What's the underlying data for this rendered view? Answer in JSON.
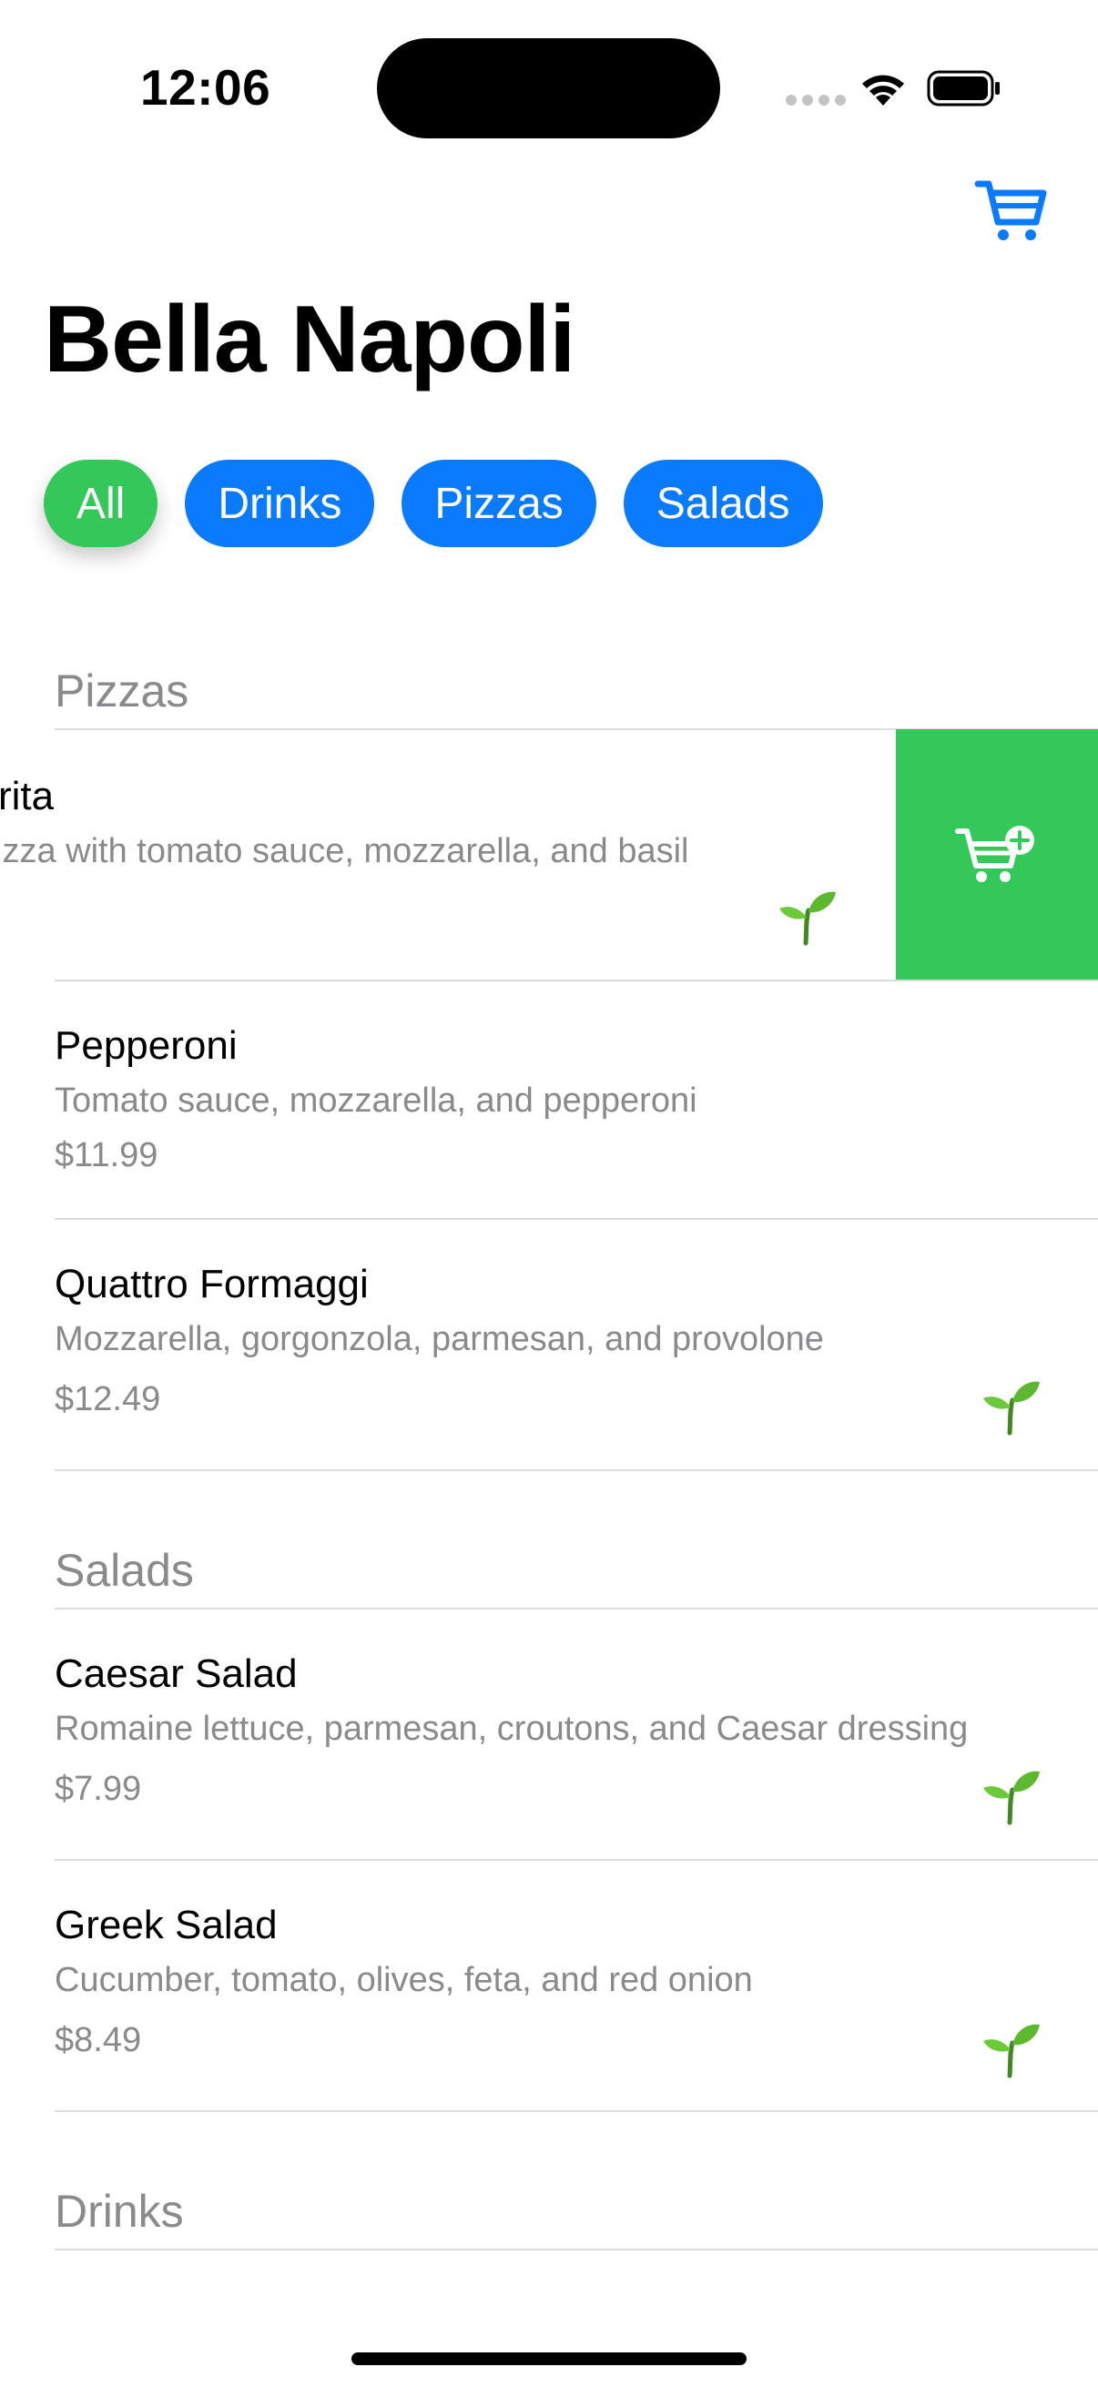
{
  "status_bar": {
    "time": "12:06"
  },
  "header": {
    "title": "Bella Napoli",
    "cart_icon": "cart-icon"
  },
  "filters": [
    {
      "label": "All",
      "active": true
    },
    {
      "label": "Drinks",
      "active": false
    },
    {
      "label": "Pizzas",
      "active": false
    },
    {
      "label": "Salads",
      "active": false
    }
  ],
  "sections": {
    "pizzas": {
      "title": "Pizzas",
      "items": [
        {
          "name": "rita",
          "description": "izza with tomato sauce, mozzarella, and basil",
          "price": "",
          "vegetarian": true
        },
        {
          "name": "Pepperoni",
          "description": "Tomato sauce, mozzarella, and pepperoni",
          "price": "$11.99",
          "vegetarian": false
        },
        {
          "name": "Quattro Formaggi",
          "description": "Mozzarella, gorgonzola, parmesan, and provolone",
          "price": "$12.49",
          "vegetarian": true
        }
      ]
    },
    "salads": {
      "title": "Salads",
      "items": [
        {
          "name": "Caesar Salad",
          "description": "Romaine lettuce, parmesan, croutons, and Caesar dressing",
          "price": "$7.99",
          "vegetarian": true
        },
        {
          "name": "Greek Salad",
          "description": "Cucumber, tomato, olives, feta, and red onion",
          "price": "$8.49",
          "vegetarian": true
        }
      ]
    },
    "drinks": {
      "title": "Drinks"
    }
  },
  "swipe_action": {
    "icon": "cart-add-icon",
    "color": "#34c759"
  },
  "colors": {
    "accent": "#0a7aff",
    "active_chip": "#34c759",
    "secondary_text": "#8a8a8e"
  }
}
